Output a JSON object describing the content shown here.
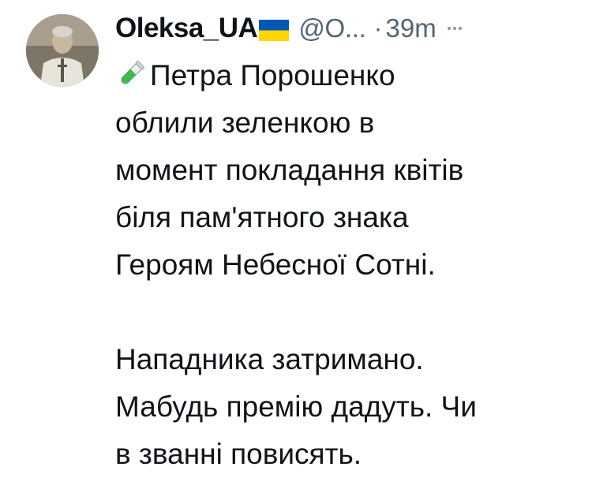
{
  "tweet": {
    "author": {
      "display_name": "Oleksa_UA",
      "flag_icon": "ukraine-flag-icon",
      "handle": "@O...",
      "avatar_icon": "avatar"
    },
    "separator": "·",
    "time": "39m",
    "more_icon": "more-options-icon",
    "emoji_icon": "test-tube-icon",
    "lines": [
      "Петра Порошенко",
      "облили зеленкою в",
      "момент покладання квітів",
      "біля пам'ятного знака",
      "Героям Небесної Сотні.",
      "",
      "Нападника затримано.",
      "Мабудь премію дадуть. Чи",
      "в званні повисять."
    ]
  },
  "colors": {
    "text": "#0f1419",
    "secondary": "#536471",
    "flag_blue": "#0057b7",
    "flag_yellow": "#ffd700",
    "tube_green": "#3fb950"
  }
}
